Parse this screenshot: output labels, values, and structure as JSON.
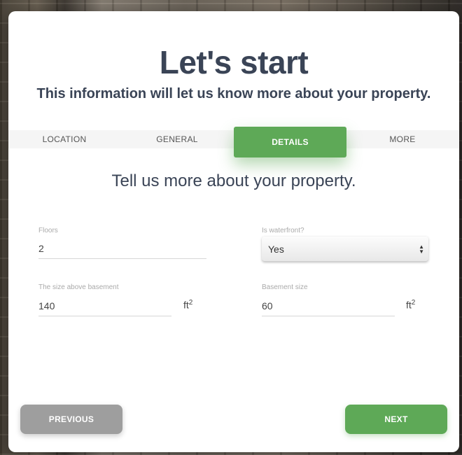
{
  "header": {
    "title": "Let's start",
    "subtitle": "This information will let us know more about your property."
  },
  "tabs": [
    {
      "label": "LOCATION",
      "active": false
    },
    {
      "label": "GENERAL",
      "active": false
    },
    {
      "label": "DETAILS",
      "active": true
    },
    {
      "label": "MORE",
      "active": false
    }
  ],
  "lead": "Tell us more about your property.",
  "form": {
    "floors": {
      "label": "Floors",
      "value": "2"
    },
    "waterfront": {
      "label": "Is waterfront?",
      "value": "Yes"
    },
    "size_above_basement": {
      "label": "The size above basement",
      "value": "140",
      "unit": "ft",
      "unit_exp": "2"
    },
    "basement_size": {
      "label": "Basement size",
      "value": "60",
      "unit": "ft",
      "unit_exp": "2"
    }
  },
  "buttons": {
    "previous": "PREVIOUS",
    "next": "NEXT"
  },
  "colors": {
    "accent": "#5ea957",
    "heading": "#3a4456",
    "secondary_button": "#9e9e9e"
  }
}
